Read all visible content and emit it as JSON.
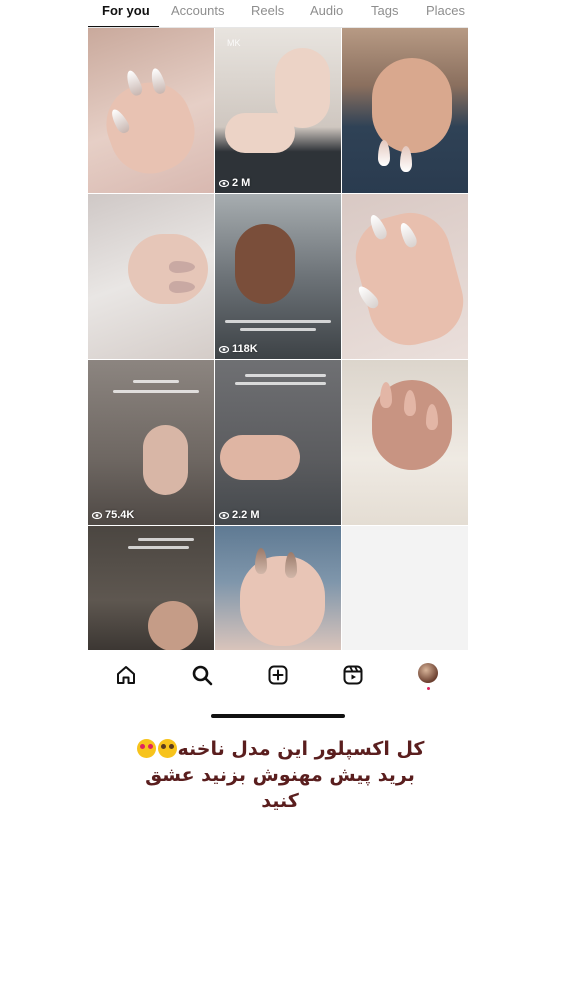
{
  "tabs": [
    {
      "label": "For you",
      "active": true
    },
    {
      "label": "Accounts",
      "active": false
    },
    {
      "label": "Reels",
      "active": false
    },
    {
      "label": "Audio",
      "active": false
    },
    {
      "label": "Tags",
      "active": false
    },
    {
      "label": "Places",
      "active": false
    }
  ],
  "grid": {
    "tiles": [
      {
        "views": ""
      },
      {
        "views": "2 M",
        "watermark": "MK"
      },
      {
        "views": ""
      },
      {
        "views": ""
      },
      {
        "views": "118K"
      },
      {
        "views": ""
      },
      {
        "views": "75.4K"
      },
      {
        "views": "2.2 M"
      },
      {
        "views": ""
      },
      {
        "views": ""
      },
      {
        "views": ""
      },
      {
        "views": ""
      }
    ]
  },
  "bottom_nav": {
    "items": [
      "home-icon",
      "search-icon",
      "create-icon",
      "reels-icon",
      "profile-avatar"
    ]
  },
  "caption": {
    "line1": "کل اکسپلور این مدل ناخنه",
    "line2": "برید پیش مهنوش بزنید عشق",
    "line3": "کنید",
    "emojis": [
      "pleading-face",
      "heart-eyes-face"
    ]
  },
  "colors": {
    "caption": "#5a1e1e",
    "active_tab": "#111111",
    "inactive_tab": "#8e8e8e"
  }
}
